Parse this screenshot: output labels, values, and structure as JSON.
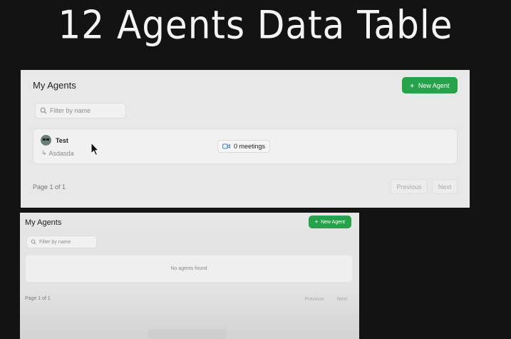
{
  "slide_title": "12 Agents Data Table",
  "panel_with_data": {
    "heading": "My Agents",
    "new_agent_label": "New Agent",
    "filter_placeholder": "Filter by name",
    "agents": [
      {
        "name": "Test",
        "instructions": "Asdasda",
        "meetings": "0 meetings"
      }
    ],
    "page_text": "Page 1 of 1",
    "previous_label": "Previous",
    "next_label": "Next"
  },
  "panel_empty": {
    "heading": "My Agents",
    "new_agent_label": "New Agent",
    "filter_placeholder": "Filter by name",
    "empty_text": "No agents found",
    "page_text": "Page 1 of 1",
    "previous_label": "Previous",
    "next_label": "Next"
  },
  "icons": {
    "plus": "plus-icon",
    "search": "search-icon",
    "video": "video-icon",
    "reply_arrow": "corner-down-right-icon",
    "cursor": "mouse-cursor-icon"
  },
  "colors": {
    "background": "#131313",
    "panel": "#e8e8e8",
    "accent_green": "#25a24a",
    "video_icon": "#3f7fd4"
  }
}
